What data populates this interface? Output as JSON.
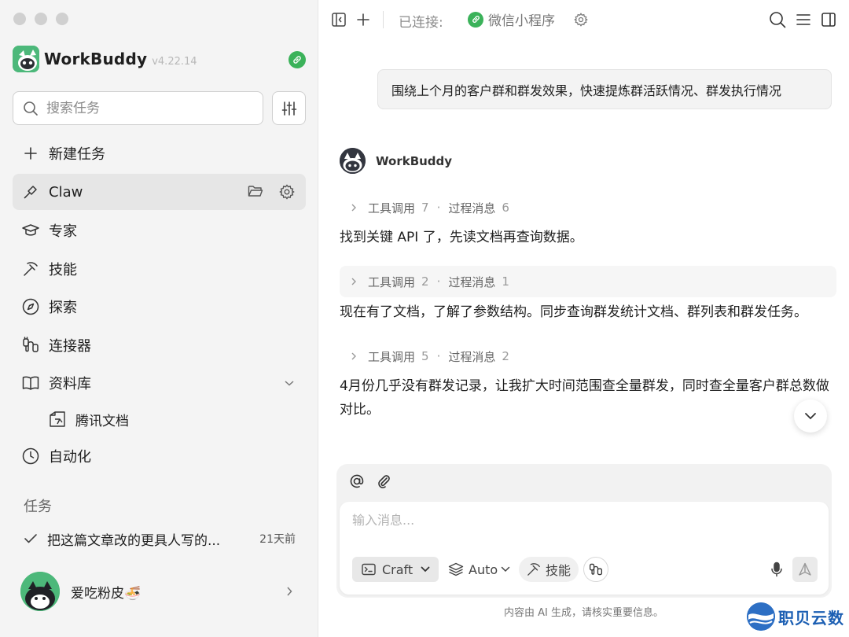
{
  "sidebar": {
    "brand": {
      "name": "WorkBuddy",
      "version": "v4.22.14"
    },
    "search": {
      "placeholder": "搜索任务"
    },
    "nav": {
      "new_task": "新建任务",
      "claw": "Claw",
      "experts": "专家",
      "skills": "技能",
      "explore": "探索",
      "connectors": "连接器",
      "library": "资料库",
      "library_sub": "腾讯文档",
      "automation": "自动化"
    },
    "tasks_title": "任务",
    "tasks": [
      {
        "title": "把这篇文章改的更具人写的...",
        "time": "21天前"
      }
    ],
    "user": {
      "name": "爱吃粉皮🍜"
    }
  },
  "topbar": {
    "connected_label": "已连接:",
    "connected_app": "微信小程序"
  },
  "chat": {
    "user_message": "围绕上个月的客户群和群发效果，快速提炼群活跃情况、群发执行情况",
    "bot_name": "WorkBuddy",
    "tool_call_label": "工具调用",
    "process_msg_label": "过程消息",
    "dot": "·",
    "steps": [
      {
        "tool_calls": "7",
        "process_msgs": "6",
        "text": "找到关键 API 了，先读文档再查询数据。"
      },
      {
        "tool_calls": "2",
        "process_msgs": "1",
        "text": "现在有了文档，了解了参数结构。同步查询群发统计文档、群列表和群发任务。"
      },
      {
        "tool_calls": "5",
        "process_msgs": "2",
        "text": "4月份几乎没有群发记录，让我扩大时间范围查全量群发，同时查全量客户群总数做对比。"
      }
    ]
  },
  "composer": {
    "placeholder": "输入消息...",
    "mode": "Craft",
    "model": "Auto",
    "skills": "技能"
  },
  "disclaimer": "内容由 AI 生成，请核实重要信息。",
  "watermark": "职贝云数",
  "colors": {
    "accent_green": "#3bb25a",
    "brand_green": "#4cb87a",
    "watermark_blue": "#1c5fb3"
  }
}
